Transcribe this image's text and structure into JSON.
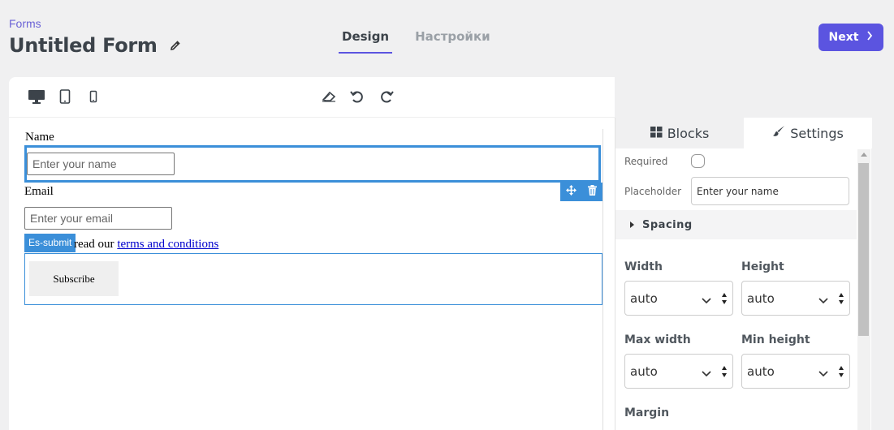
{
  "header": {
    "breadcrumb": "Forms",
    "title": "Untitled Form",
    "tabs": [
      {
        "label": "Design",
        "active": true
      },
      {
        "label": "Настройки",
        "active": false
      }
    ],
    "next_label": "Next"
  },
  "toolbar": {
    "devices": [
      "desktop-icon",
      "tablet-icon",
      "mobile-icon"
    ],
    "actions": [
      "eraser-icon",
      "undo-icon",
      "redo-icon"
    ]
  },
  "form": {
    "name_label": "Name",
    "name_placeholder": "Enter your name",
    "email_label": "Email",
    "email_placeholder": "Enter your email",
    "badge": "Es-submit",
    "terms_prefix": "read our",
    "terms_link": "terms and conditions",
    "submit_label": "Subscribe"
  },
  "panel": {
    "tabs": [
      {
        "label": "Blocks",
        "icon": "blocks-icon",
        "active": false
      },
      {
        "label": "Settings",
        "icon": "brush-icon",
        "active": true
      }
    ],
    "required_label": "Required",
    "required_checked": false,
    "placeholder_label": "Placeholder",
    "placeholder_value": "Enter your name",
    "spacing_label": "Spacing",
    "width_label": "Width",
    "width_value": "auto",
    "height_label": "Height",
    "height_value": "auto",
    "max_width_label": "Max width",
    "max_width_value": "auto",
    "min_height_label": "Min height",
    "min_height_value": "auto",
    "margin_label": "Margin"
  },
  "colors": {
    "accent": "#5b54e0",
    "selection": "#3b8fd9"
  }
}
